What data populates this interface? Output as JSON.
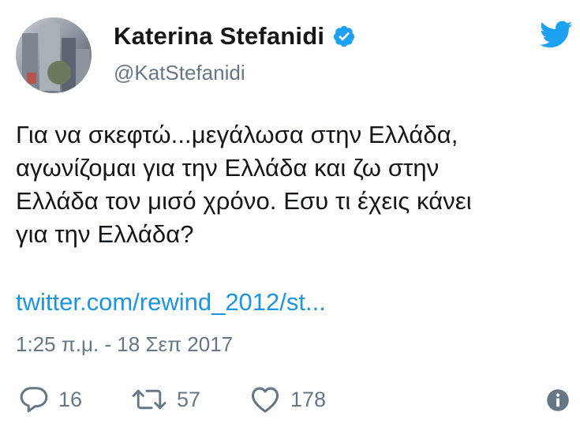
{
  "user": {
    "display_name": "Katerina Stefanidi",
    "handle": "@KatStefanidi",
    "verified": true
  },
  "tweet": {
    "text": "Για να σκεφτώ...μεγάλωσα στην Ελλάδα,\nαγωνίζομαι για την Ελλάδα και ζω στην\nΕλλάδα τον μισό χρόνο. Εσυ τι έχεις κάνει\nγια την Ελλάδα?",
    "link": "twitter.com/rewind_2012/st...",
    "timestamp": "1:25 π.μ. - 18 Σεπ 2017"
  },
  "actions": {
    "replies": "16",
    "retweets": "57",
    "likes": "178"
  },
  "icons": {
    "brand": "twitter-bird-icon",
    "verified": "verified-badge-icon",
    "reply": "reply-icon",
    "retweet": "retweet-icon",
    "like": "heart-icon",
    "info": "info-icon"
  },
  "colors": {
    "twitter_blue": "#1da1f2",
    "link_blue": "#1b95e0",
    "muted_gray": "#657786",
    "text": "#14171a"
  }
}
